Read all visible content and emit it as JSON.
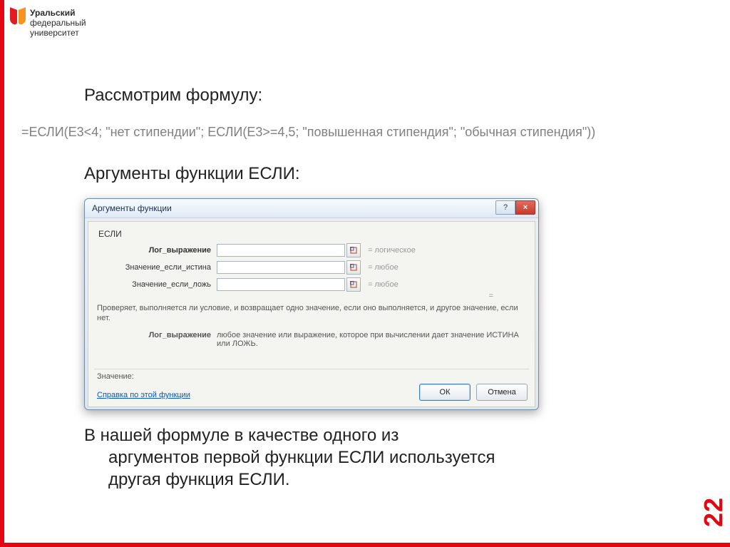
{
  "logo": {
    "line1_bold": "Уральский",
    "line2": "федеральный",
    "line3": "университет"
  },
  "slide_number": "22",
  "text": {
    "heading1": "Рассмотрим формулу:",
    "formula": "=ЕСЛИ(E3<4; \"нет стипендии\"; ЕСЛИ(E3>=4,5; \"повышенная стипендия\"; \"обычная стипендия\"))",
    "heading2": "Аргументы функции ЕСЛИ:",
    "para_line1": "В нашей формуле в качестве одного из",
    "para_line2": "аргументов первой функции ЕСЛИ используется",
    "para_line3": "другая функция ЕСЛИ."
  },
  "dialog": {
    "title": "Аргументы функции",
    "function_name": "ЕСЛИ",
    "args": [
      {
        "label": "Лог_выражение",
        "bold": true,
        "value": "",
        "kind": "логическое"
      },
      {
        "label": "Значение_если_истина",
        "bold": false,
        "value": "",
        "kind": "любое"
      },
      {
        "label": "Значение_если_ложь",
        "bold": false,
        "value": "",
        "kind": "любое"
      }
    ],
    "eq_symbol": "=",
    "description": "Проверяет, выполняется ли условие, и возвращает одно значение, если оно выполняется, и другое значение, если нет.",
    "arg_desc_label": "Лог_выражение",
    "arg_desc_text": "любое значение или выражение, которое при вычислении дает значение ИСТИНА или ЛОЖЬ.",
    "result_label": "Значение:",
    "help_link": "Справка по этой функции",
    "ok": "ОК",
    "cancel": "Отмена",
    "help_icon": "?",
    "close_icon": "×"
  }
}
